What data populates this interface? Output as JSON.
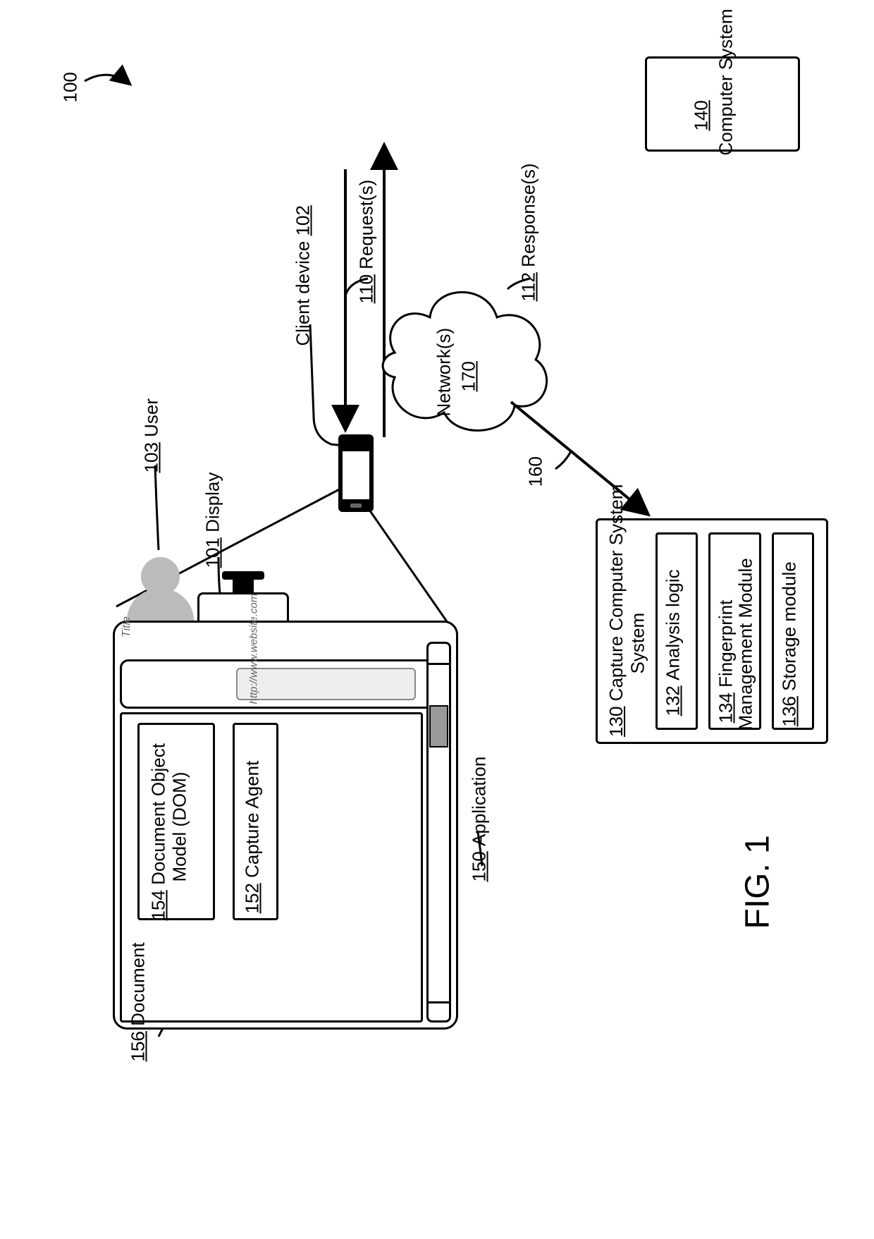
{
  "figure_ref": "100",
  "figure_label": "FIG. 1",
  "user": {
    "ref": "103",
    "text": "User"
  },
  "display": {
    "ref": "101",
    "text": "Display"
  },
  "client_device": {
    "ref": "102",
    "text": "Client device"
  },
  "requests": {
    "ref": "110",
    "text": "Request(s)"
  },
  "responses": {
    "ref": "112",
    "text": "Response(s)"
  },
  "computer_system": {
    "ref": "140",
    "text": "Computer System"
  },
  "networks": {
    "ref": "170",
    "text": "Network(s)"
  },
  "capture_link": "160",
  "capture_system": {
    "ref": "130",
    "text": "Capture Computer System",
    "modules": [
      {
        "ref": "132",
        "text": "Analysis logic"
      },
      {
        "ref": "134",
        "text": "Fingerprint Management Module"
      },
      {
        "ref": "136",
        "text": "Storage module"
      }
    ]
  },
  "application": {
    "ref": "150",
    "text": "Application",
    "title": "Title",
    "url": "http://www.website.com",
    "doc": {
      "ref": "156",
      "text": "Document"
    },
    "dom": {
      "ref": "154",
      "text": "Document Object Model (DOM)"
    },
    "agent": {
      "ref": "152",
      "text": "Capture Agent"
    }
  }
}
